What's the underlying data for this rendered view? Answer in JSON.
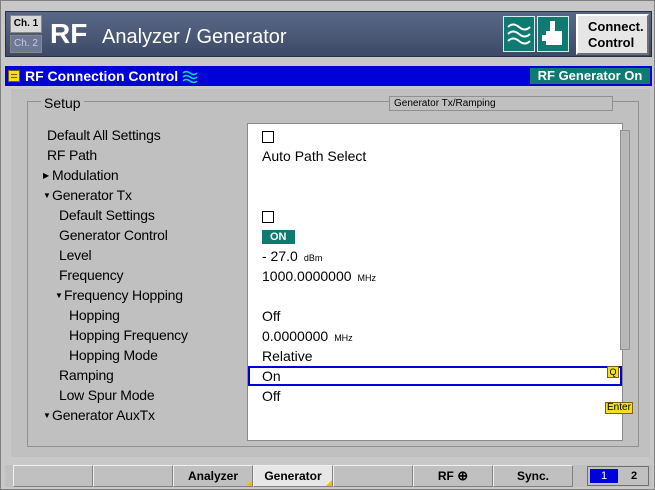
{
  "titlebar": {
    "ch1": "Ch. 1",
    "ch2": "Ch. 2",
    "rf": "RF",
    "title": "Analyzer / Generator",
    "connect_line1": "Connect.",
    "connect_line2": "Control"
  },
  "header": {
    "title": "RF Connection Control",
    "status": "RF Generator On"
  },
  "setup": {
    "label": "Setup",
    "tag": "Generator Tx/Ramping"
  },
  "tree": [
    {
      "label": "Default All Settings"
    },
    {
      "label": "RF Path"
    },
    {
      "label": "Modulation",
      "expand": "▶"
    },
    {
      "label": "Generator Tx",
      "expand": "▼"
    },
    {
      "label": "Default Settings"
    },
    {
      "label": "Generator Control"
    },
    {
      "label": "Level"
    },
    {
      "label": "Frequency"
    },
    {
      "label": "Frequency Hopping",
      "expand": "▼"
    },
    {
      "label": "Hopping"
    },
    {
      "label": "Hopping Frequency"
    },
    {
      "label": "Hopping Mode"
    },
    {
      "label": "Ramping"
    },
    {
      "label": "Low Spur Mode"
    },
    {
      "label": "Generator AuxTx",
      "expand": "▼"
    }
  ],
  "values": {
    "rf_path": "Auto Path Select",
    "generator_control": "ON",
    "level": "- 27.0",
    "level_unit": "dBm",
    "frequency": "1000.0000000",
    "frequency_unit": "MHz",
    "hopping": "Off",
    "hopping_frequency": "0.0000000",
    "hopping_frequency_unit": "MHz",
    "hopping_mode": "Relative",
    "ramping": "On",
    "low_spur_mode": "Off"
  },
  "icons": {
    "scroll": "Q",
    "enter": "Enter"
  },
  "softkeys": {
    "analyzer": "Analyzer",
    "generator": "Generator",
    "rf": "RF",
    "sync": "Sync.",
    "page1": "1",
    "page2": "2"
  },
  "colors": {
    "header_blue": "#0000d8",
    "teal_status": "#0f7a72",
    "selection_border": "#0000d8"
  }
}
